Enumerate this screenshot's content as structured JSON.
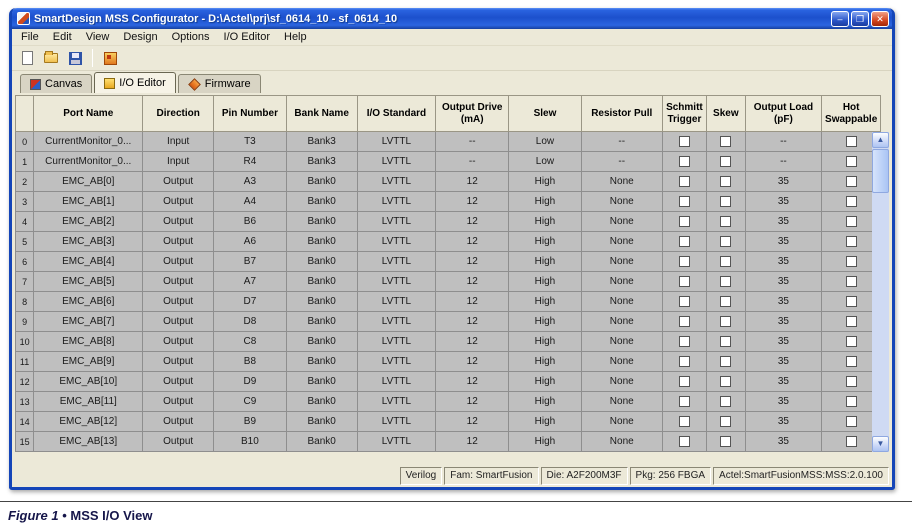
{
  "window": {
    "title": "SmartDesign MSS Configurator - D:\\Actel\\prj\\sf_0614_10 - sf_0614_10",
    "controls": {
      "minimize": "–",
      "maximize": "❐",
      "close": "✕"
    }
  },
  "menubar": {
    "items": [
      "File",
      "Edit",
      "View",
      "Design",
      "Options",
      "I/O Editor",
      "Help"
    ]
  },
  "toolbar": {
    "icons": [
      "new-document",
      "open-folder",
      "save",
      "generate"
    ]
  },
  "tabs": [
    {
      "label": "Canvas",
      "active": false
    },
    {
      "label": "I/O Editor",
      "active": true
    },
    {
      "label": "Firmware",
      "active": false
    }
  ],
  "table": {
    "columns": [
      "Port Name",
      "Direction",
      "Pin Number",
      "Bank Name",
      "I/O Standard",
      "Output Drive\n(mA)",
      "Slew",
      "Resistor Pull",
      "Schmitt\nTrigger",
      "Skew",
      "Output Load\n(pF)",
      "Hot\nSwappable"
    ],
    "rows": [
      {
        "num": "0",
        "port": "CurrentMonitor_0...",
        "direction": "Input",
        "pin": "T3",
        "bank": "Bank3",
        "std": "LVTTL",
        "drive": "--",
        "slew": "Low",
        "pull": "--",
        "schmitt": false,
        "skew": false,
        "load": "--",
        "hot_swappable": false
      },
      {
        "num": "1",
        "port": "CurrentMonitor_0...",
        "direction": "Input",
        "pin": "R4",
        "bank": "Bank3",
        "std": "LVTTL",
        "drive": "--",
        "slew": "Low",
        "pull": "--",
        "schmitt": false,
        "skew": false,
        "load": "--",
        "hot_swappable": false
      },
      {
        "num": "2",
        "port": "EMC_AB[0]",
        "direction": "Output",
        "pin": "A3",
        "bank": "Bank0",
        "std": "LVTTL",
        "drive": "12",
        "slew": "High",
        "pull": "None",
        "schmitt": false,
        "skew": false,
        "load": "35",
        "hot_swappable": false
      },
      {
        "num": "3",
        "port": "EMC_AB[1]",
        "direction": "Output",
        "pin": "A4",
        "bank": "Bank0",
        "std": "LVTTL",
        "drive": "12",
        "slew": "High",
        "pull": "None",
        "schmitt": false,
        "skew": false,
        "load": "35",
        "hot_swappable": false
      },
      {
        "num": "4",
        "port": "EMC_AB[2]",
        "direction": "Output",
        "pin": "B6",
        "bank": "Bank0",
        "std": "LVTTL",
        "drive": "12",
        "slew": "High",
        "pull": "None",
        "schmitt": false,
        "skew": false,
        "load": "35",
        "hot_swappable": false
      },
      {
        "num": "5",
        "port": "EMC_AB[3]",
        "direction": "Output",
        "pin": "A6",
        "bank": "Bank0",
        "std": "LVTTL",
        "drive": "12",
        "slew": "High",
        "pull": "None",
        "schmitt": false,
        "skew": false,
        "load": "35",
        "hot_swappable": false
      },
      {
        "num": "6",
        "port": "EMC_AB[4]",
        "direction": "Output",
        "pin": "B7",
        "bank": "Bank0",
        "std": "LVTTL",
        "drive": "12",
        "slew": "High",
        "pull": "None",
        "schmitt": false,
        "skew": false,
        "load": "35",
        "hot_swappable": false
      },
      {
        "num": "7",
        "port": "EMC_AB[5]",
        "direction": "Output",
        "pin": "A7",
        "bank": "Bank0",
        "std": "LVTTL",
        "drive": "12",
        "slew": "High",
        "pull": "None",
        "schmitt": false,
        "skew": false,
        "load": "35",
        "hot_swappable": false
      },
      {
        "num": "8",
        "port": "EMC_AB[6]",
        "direction": "Output",
        "pin": "D7",
        "bank": "Bank0",
        "std": "LVTTL",
        "drive": "12",
        "slew": "High",
        "pull": "None",
        "schmitt": false,
        "skew": false,
        "load": "35",
        "hot_swappable": false
      },
      {
        "num": "9",
        "port": "EMC_AB[7]",
        "direction": "Output",
        "pin": "D8",
        "bank": "Bank0",
        "std": "LVTTL",
        "drive": "12",
        "slew": "High",
        "pull": "None",
        "schmitt": false,
        "skew": false,
        "load": "35",
        "hot_swappable": false
      },
      {
        "num": "10",
        "port": "EMC_AB[8]",
        "direction": "Output",
        "pin": "C8",
        "bank": "Bank0",
        "std": "LVTTL",
        "drive": "12",
        "slew": "High",
        "pull": "None",
        "schmitt": false,
        "skew": false,
        "load": "35",
        "hot_swappable": false
      },
      {
        "num": "11",
        "port": "EMC_AB[9]",
        "direction": "Output",
        "pin": "B8",
        "bank": "Bank0",
        "std": "LVTTL",
        "drive": "12",
        "slew": "High",
        "pull": "None",
        "schmitt": false,
        "skew": false,
        "load": "35",
        "hot_swappable": false
      },
      {
        "num": "12",
        "port": "EMC_AB[10]",
        "direction": "Output",
        "pin": "D9",
        "bank": "Bank0",
        "std": "LVTTL",
        "drive": "12",
        "slew": "High",
        "pull": "None",
        "schmitt": false,
        "skew": false,
        "load": "35",
        "hot_swappable": false
      },
      {
        "num": "13",
        "port": "EMC_AB[11]",
        "direction": "Output",
        "pin": "C9",
        "bank": "Bank0",
        "std": "LVTTL",
        "drive": "12",
        "slew": "High",
        "pull": "None",
        "schmitt": false,
        "skew": false,
        "load": "35",
        "hot_swappable": false
      },
      {
        "num": "14",
        "port": "EMC_AB[12]",
        "direction": "Output",
        "pin": "B9",
        "bank": "Bank0",
        "std": "LVTTL",
        "drive": "12",
        "slew": "High",
        "pull": "None",
        "schmitt": false,
        "skew": false,
        "load": "35",
        "hot_swappable": false
      },
      {
        "num": "15",
        "port": "EMC_AB[13]",
        "direction": "Output",
        "pin": "B10",
        "bank": "Bank0",
        "std": "LVTTL",
        "drive": "12",
        "slew": "High",
        "pull": "None",
        "schmitt": false,
        "skew": false,
        "load": "35",
        "hot_swappable": false
      }
    ]
  },
  "statusbar": {
    "segments": [
      "Verilog",
      "Fam: SmartFusion",
      "Die: A2F200M3F",
      "Pkg: 256 FBGA",
      "Actel:SmartFusionMSS:MSS:2.0.100"
    ]
  },
  "figure_caption": {
    "label": "Figure 1",
    "separator": "•",
    "title": "MSS I/O View"
  }
}
